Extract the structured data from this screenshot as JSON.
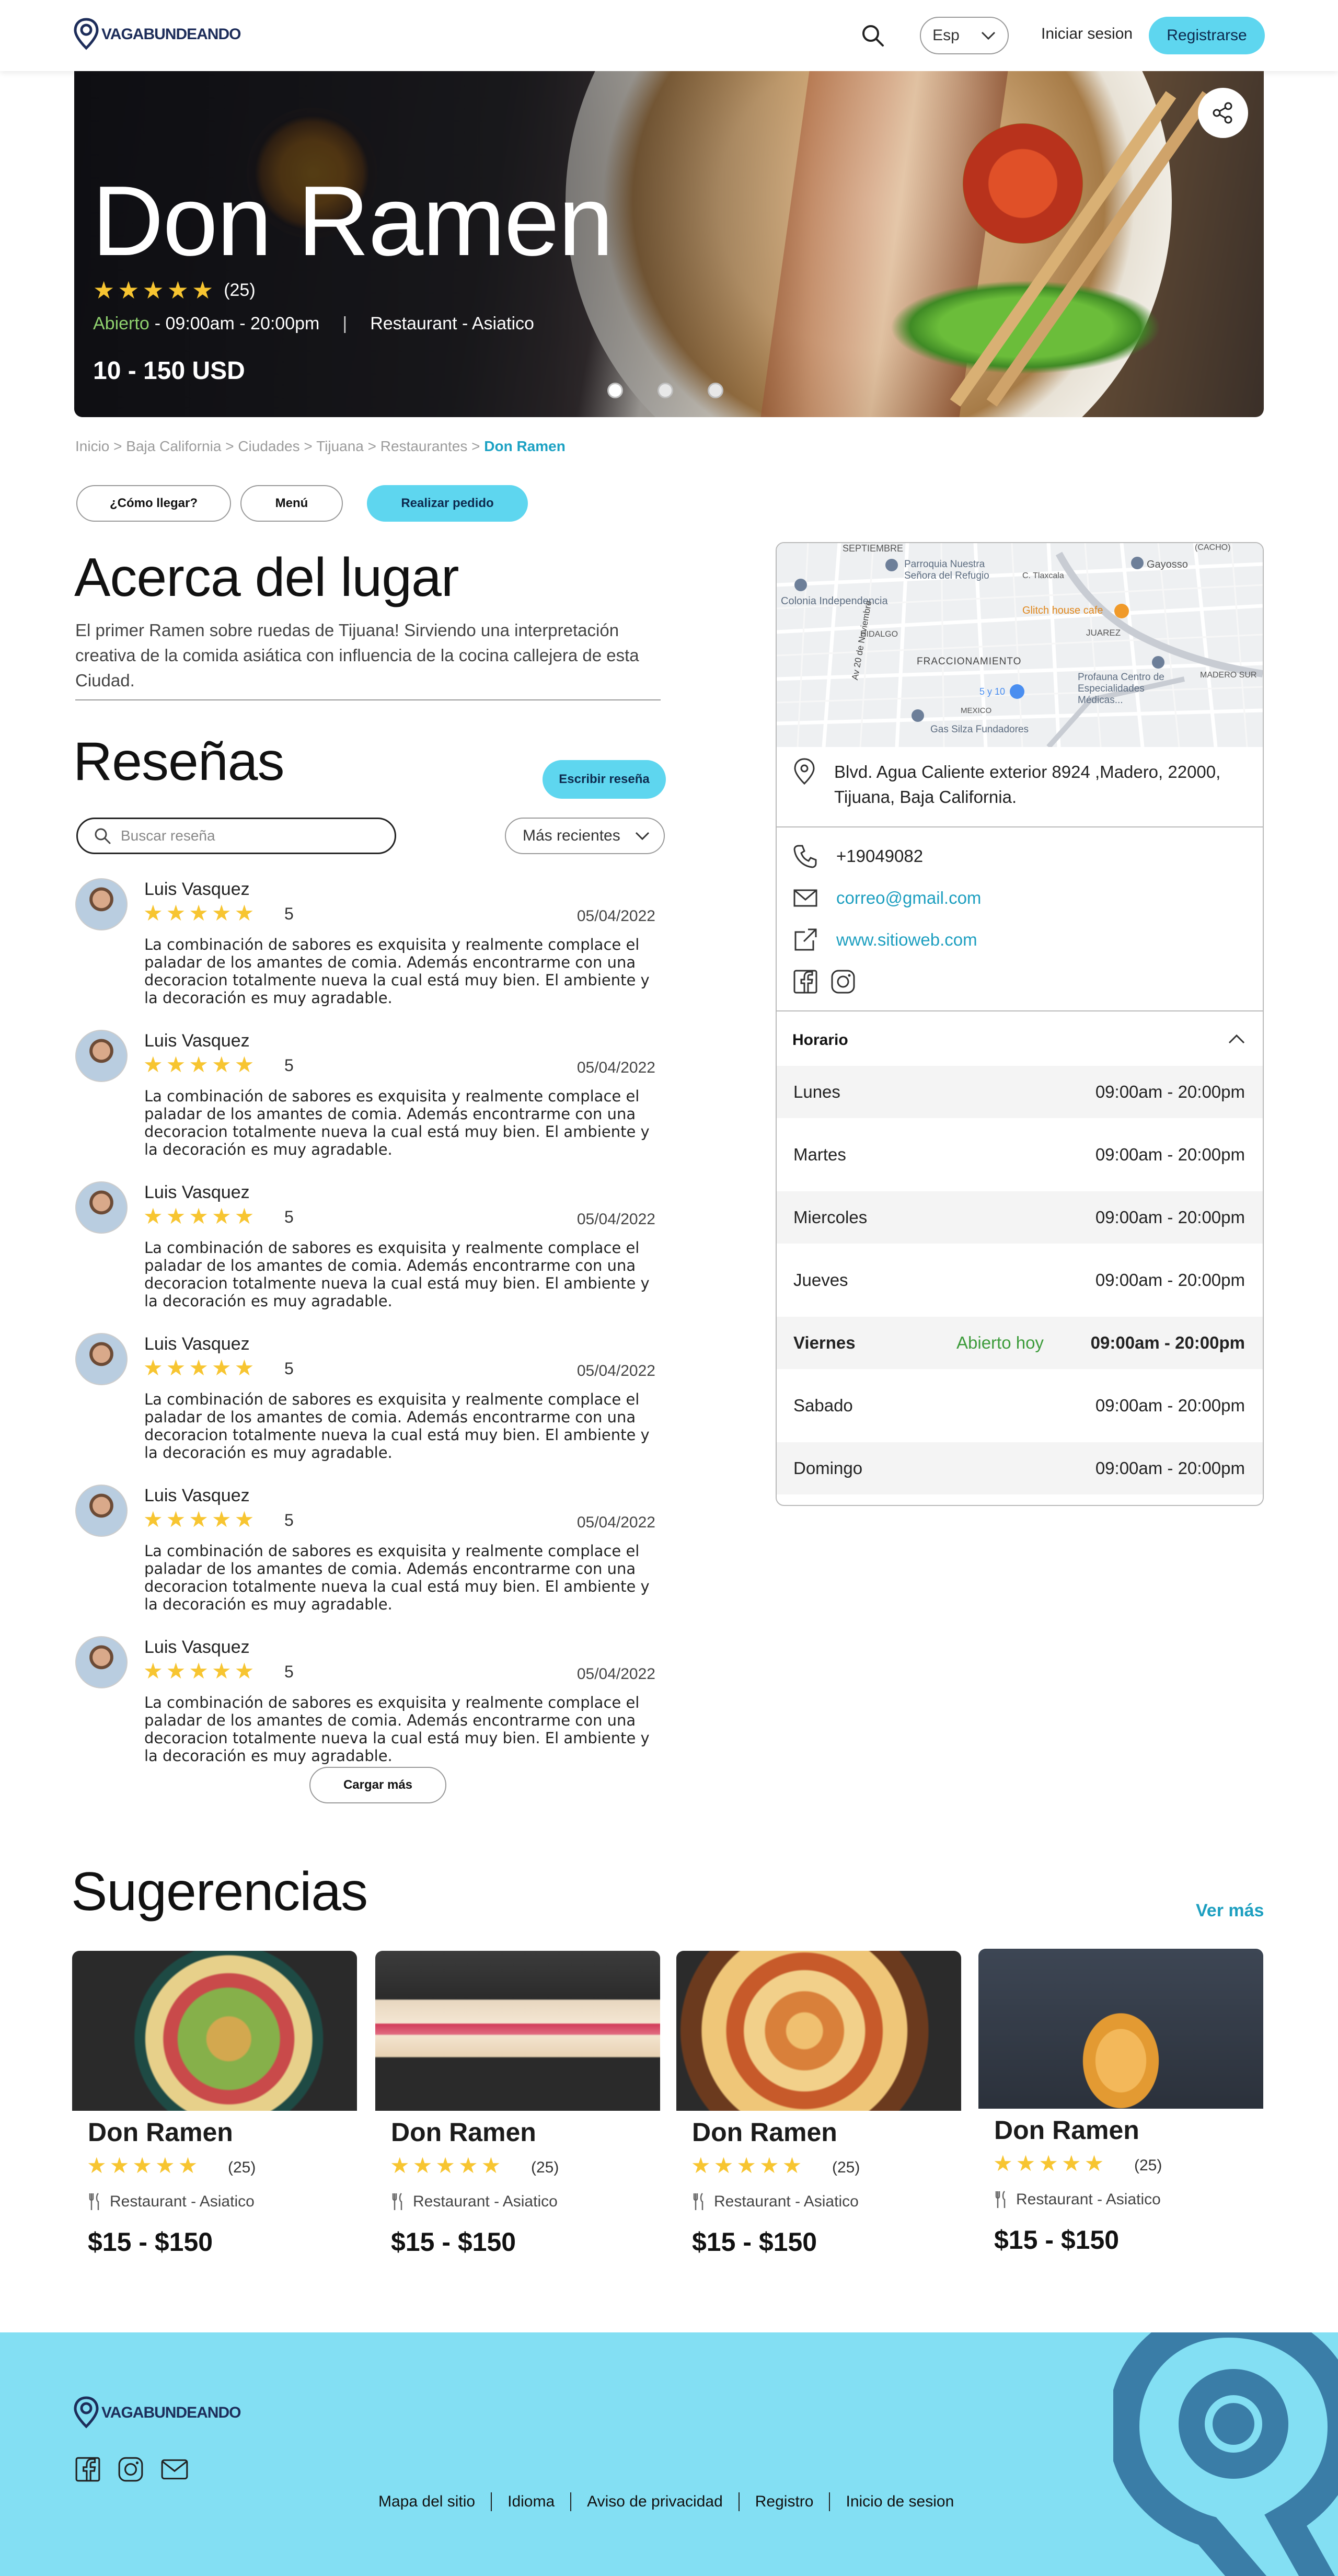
{
  "header": {
    "logo_text": "VAGABUNDEANDO",
    "language": "Esp",
    "login_label": "Iniciar sesion",
    "register_label": "Registrarse"
  },
  "hero": {
    "title": "Don Ramen",
    "rating": 5,
    "rating_count": "(25)",
    "status": "Abierto",
    "hours": "- 09:00am - 20:00pm",
    "category": "Restaurant - Asiatico",
    "price": "10 - 150 USD",
    "carousel_dots": 3
  },
  "breadcrumb": {
    "items": [
      "Inicio",
      "Baja California",
      "Ciudades",
      "Tijuana",
      "Restaurantes"
    ],
    "current": "Don Ramen",
    "separator": ">"
  },
  "actions": {
    "directions": "¿Cómo llegar?",
    "menu": "Menú",
    "order": "Realizar pedido"
  },
  "about": {
    "title": "Acerca del lugar",
    "text": "El primer Ramen sobre ruedas de Tijuana! Sirviendo una interpretación creativa de la comida asiática con influencia de la cocina callejera de esta Ciudad."
  },
  "reviews": {
    "title": "Reseñas",
    "write_label": "Escribir reseña",
    "search_placeholder": "Buscar reseña",
    "sort_label": "Más recientes",
    "load_more": "Cargar más",
    "items": [
      {
        "name": "Luis Vasquez",
        "stars": 5,
        "score": "5",
        "date": "05/04/2022",
        "text": "La combinación de sabores es exquisita y realmente complace el paladar de los amantes de comia. Además encontrarme con una decoracion totalmente nueva la cual está muy bien. El ambiente y la decoración es muy agradable."
      },
      {
        "name": "Luis Vasquez",
        "stars": 5,
        "score": "5",
        "date": "05/04/2022",
        "text": "La combinación de sabores es exquisita y realmente complace el paladar de los amantes de comia. Además encontrarme con una decoracion totalmente nueva la cual está muy bien. El ambiente y la decoración es muy agradable."
      },
      {
        "name": "Luis Vasquez",
        "stars": 5,
        "score": "5",
        "date": "05/04/2022",
        "text": "La combinación de sabores es exquisita y realmente complace el paladar de los amantes de comia. Además encontrarme con una decoracion totalmente nueva la cual está muy bien. El ambiente y la decoración es muy agradable."
      },
      {
        "name": "Luis Vasquez",
        "stars": 5,
        "score": "5",
        "date": "05/04/2022",
        "text": "La combinación de sabores es exquisita y realmente complace el paladar de los amantes de comia. Además encontrarme con una decoracion totalmente nueva la cual está muy bien. El ambiente y la decoración es muy agradable."
      },
      {
        "name": "Luis Vasquez",
        "stars": 5,
        "score": "5",
        "date": "05/04/2022",
        "text": "La combinación de sabores es exquisita y realmente complace el paladar de los amantes de comia. Además encontrarme con una decoracion totalmente nueva la cual está muy bien. El ambiente y la decoración es muy agradable."
      },
      {
        "name": "Luis Vasquez",
        "stars": 5,
        "score": "5",
        "date": "05/04/2022",
        "text": "La combinación de sabores es exquisita y realmente complace el paladar de los amantes de comia. Además encontrarme con una decoracion totalmente nueva la cual está muy bien. El ambiente y la decoración es muy agradable."
      }
    ]
  },
  "info": {
    "map_labels": {
      "septiembre": "SEPTIEMBRE",
      "parroquia": "Parroquia Nuestra Señora del Refugio",
      "tlaxcala": "C. Tlaxcala",
      "gayosso": "Gayosso",
      "cacho": "(CACHO)",
      "colonia": "Colonia Independencia",
      "glitch": "Glitch house cafe",
      "hidalgo": "HIDALGO",
      "juarez": "JUAREZ",
      "fracc": "FRACCIONAMIENTO",
      "profauna": "Profauna Centro de Especialidades Médicas...",
      "madero": "MADERO SUR",
      "cinco": "5 y 10",
      "mexico": "MEXICO",
      "gas": "Gas Silza Fundadores",
      "noviembre": "Av 20 de Noviembre"
    },
    "address": "Blvd. Agua Caliente exterior 8924 ,Madero, 22000, Tijuana, Baja California.",
    "phone": "+19049082",
    "email": "correo@gmail.com",
    "website": "www.sitioweb.com",
    "social": [
      "facebook-icon",
      "instagram-icon"
    ],
    "hours_title": "Horario",
    "today_label": "Abierto hoy",
    "hours": [
      {
        "day": "Lunes",
        "time": "09:00am - 20:00pm"
      },
      {
        "day": "Martes",
        "time": "09:00am - 20:00pm"
      },
      {
        "day": "Miercoles",
        "time": "09:00am - 20:00pm"
      },
      {
        "day": "Jueves",
        "time": "09:00am - 20:00pm"
      },
      {
        "day": "Viernes",
        "time": "09:00am - 20:00pm"
      },
      {
        "day": "Sabado",
        "time": "09:00am - 20:00pm"
      },
      {
        "day": "Domingo",
        "time": "09:00am - 20:00pm"
      }
    ]
  },
  "suggestions": {
    "title": "Sugerencias",
    "see_more": "Ver más",
    "items": [
      {
        "name": "Don Ramen",
        "stars": 5,
        "count": "(25)",
        "category": "Restaurant - Asiatico",
        "price": "$15 - $150"
      },
      {
        "name": "Don Ramen",
        "stars": 5,
        "count": "(25)",
        "category": "Restaurant - Asiatico",
        "price": "$15 - $150"
      },
      {
        "name": "Don Ramen",
        "stars": 5,
        "count": "(25)",
        "category": "Restaurant - Asiatico",
        "price": "$15 - $150"
      },
      {
        "name": "Don Ramen",
        "stars": 5,
        "count": "(25)",
        "category": "Restaurant - Asiatico",
        "price": "$15 - $150"
      }
    ]
  },
  "footer": {
    "logo_text": "VAGABUNDEANDO",
    "links": [
      "Mapa del sitio",
      "Idioma",
      "Aviso de privacidad",
      "Registro",
      "Inicio de sesion"
    ]
  },
  "colors": {
    "accent": "#5ed6ef",
    "link": "#1d9fc0",
    "star": "#f7c531",
    "open": "#3d9c3b",
    "footer_bg": "#83dff3"
  }
}
